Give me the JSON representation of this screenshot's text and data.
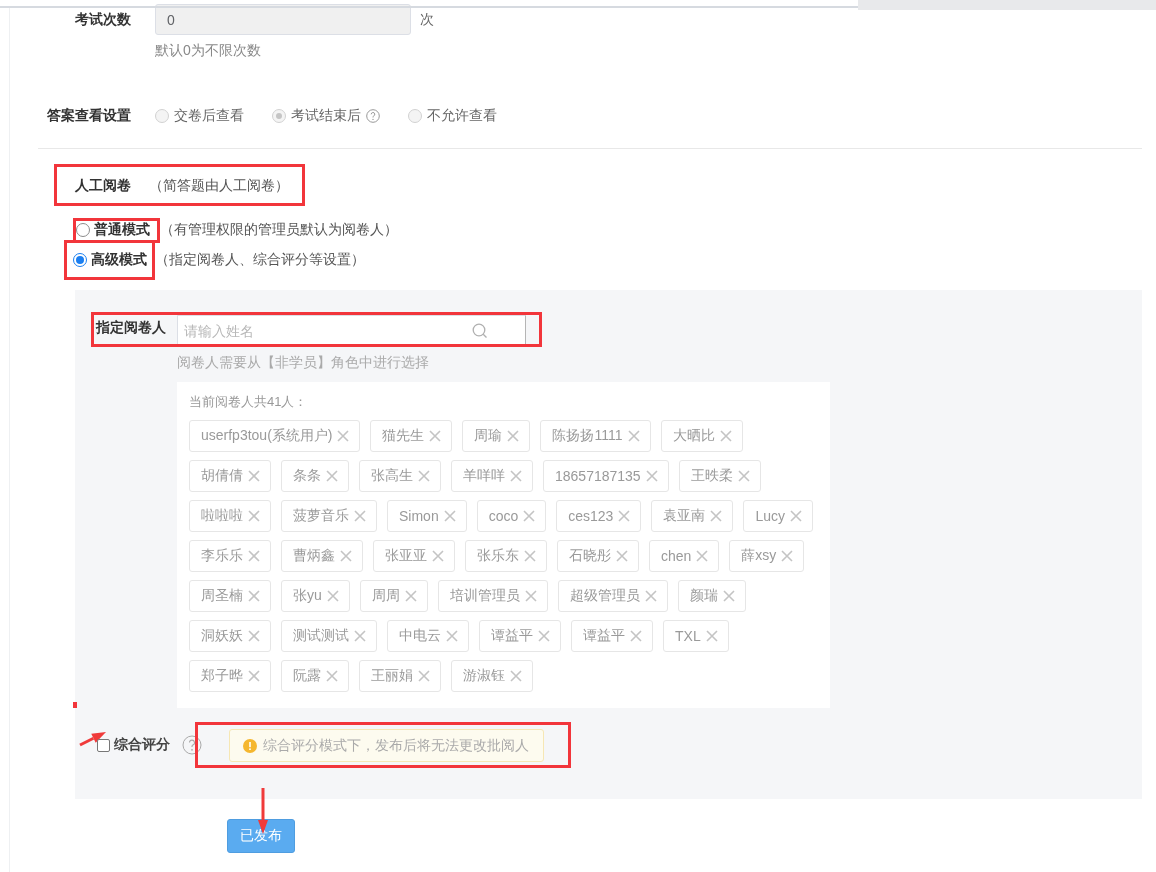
{
  "attempts": {
    "label": "考试次数",
    "value": "0",
    "unit": "次",
    "hint": "默认0为不限次数",
    "disabled": true
  },
  "answer_view": {
    "label": "答案查看设置",
    "options": [
      {
        "label": "交卷后查看",
        "selected": false,
        "disabled": true,
        "help": false
      },
      {
        "label": "考试结束后",
        "selected": true,
        "disabled": true,
        "help": true
      },
      {
        "label": "不允许查看",
        "selected": false,
        "disabled": true,
        "help": false
      }
    ]
  },
  "manual_review": {
    "title": "人工阅卷",
    "note": "（简答题由人工阅卷）",
    "highlighted": true
  },
  "modes": [
    {
      "label": "普通模式",
      "hint": "（有管理权限的管理员默认为阅卷人）",
      "selected": false,
      "highlighted": true
    },
    {
      "label": "高级模式",
      "hint": "（指定阅卷人、综合评分等设置）",
      "selected": true,
      "highlighted": true
    }
  ],
  "reviewer_field": {
    "label": "指定阅卷人",
    "placeholder": "请输入姓名",
    "hint": "阅卷人需要从【非学员】角色中进行选择",
    "highlighted": true
  },
  "reviewers": {
    "count_text": "当前阅卷人共41人：",
    "tags": [
      "userfp3tou(系统用户)",
      "猫先生",
      "周瑜",
      "陈扬扬1111",
      "大晒比",
      "胡倩倩",
      "条条",
      "张高生",
      "羊咩咩",
      "18657187135",
      "王昳柔",
      "啦啦啦",
      "菠萝音乐",
      "Simon",
      "coco",
      "ces123",
      "袁亚南",
      "Lucy",
      "李乐乐",
      "曹炳鑫",
      "张亚亚",
      "张乐东",
      "石晓彤",
      "chen",
      "薛xsy",
      "周圣楠",
      "张yu",
      "周周",
      "培训管理员",
      "超级管理员",
      "颜瑞",
      "洞妖妖",
      "测试测试",
      "中电云",
      "谭益平",
      "谭益平",
      "TXL",
      "郑子晔",
      "阮露",
      "王丽娟",
      "游淑钰"
    ]
  },
  "composite": {
    "label": "综合评分",
    "checked": false,
    "arrow": true,
    "warning": "综合评分模式下，发布后将无法更改批阅人",
    "highlighted": true
  },
  "publish": {
    "label": "已发布",
    "arrow": true
  }
}
